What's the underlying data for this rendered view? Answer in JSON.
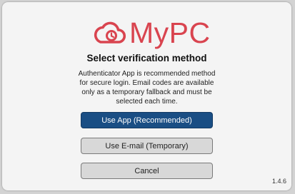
{
  "app": {
    "logo_text": "MyPC",
    "brand_color": "#d9444f",
    "logo_icon": "cloud-clock-icon"
  },
  "dialog": {
    "heading": "Select verification method",
    "description": "Authenticator App is recommended method for secure login. Email codes are available only as a temporary fallback and must be selected each time.",
    "version": "1.4.6"
  },
  "buttons": {
    "use_app_label": "Use App (Recommended)",
    "use_email_label": "Use E-mail (Temporary)",
    "cancel_label": "Cancel",
    "primary_color": "#1a4e84"
  }
}
